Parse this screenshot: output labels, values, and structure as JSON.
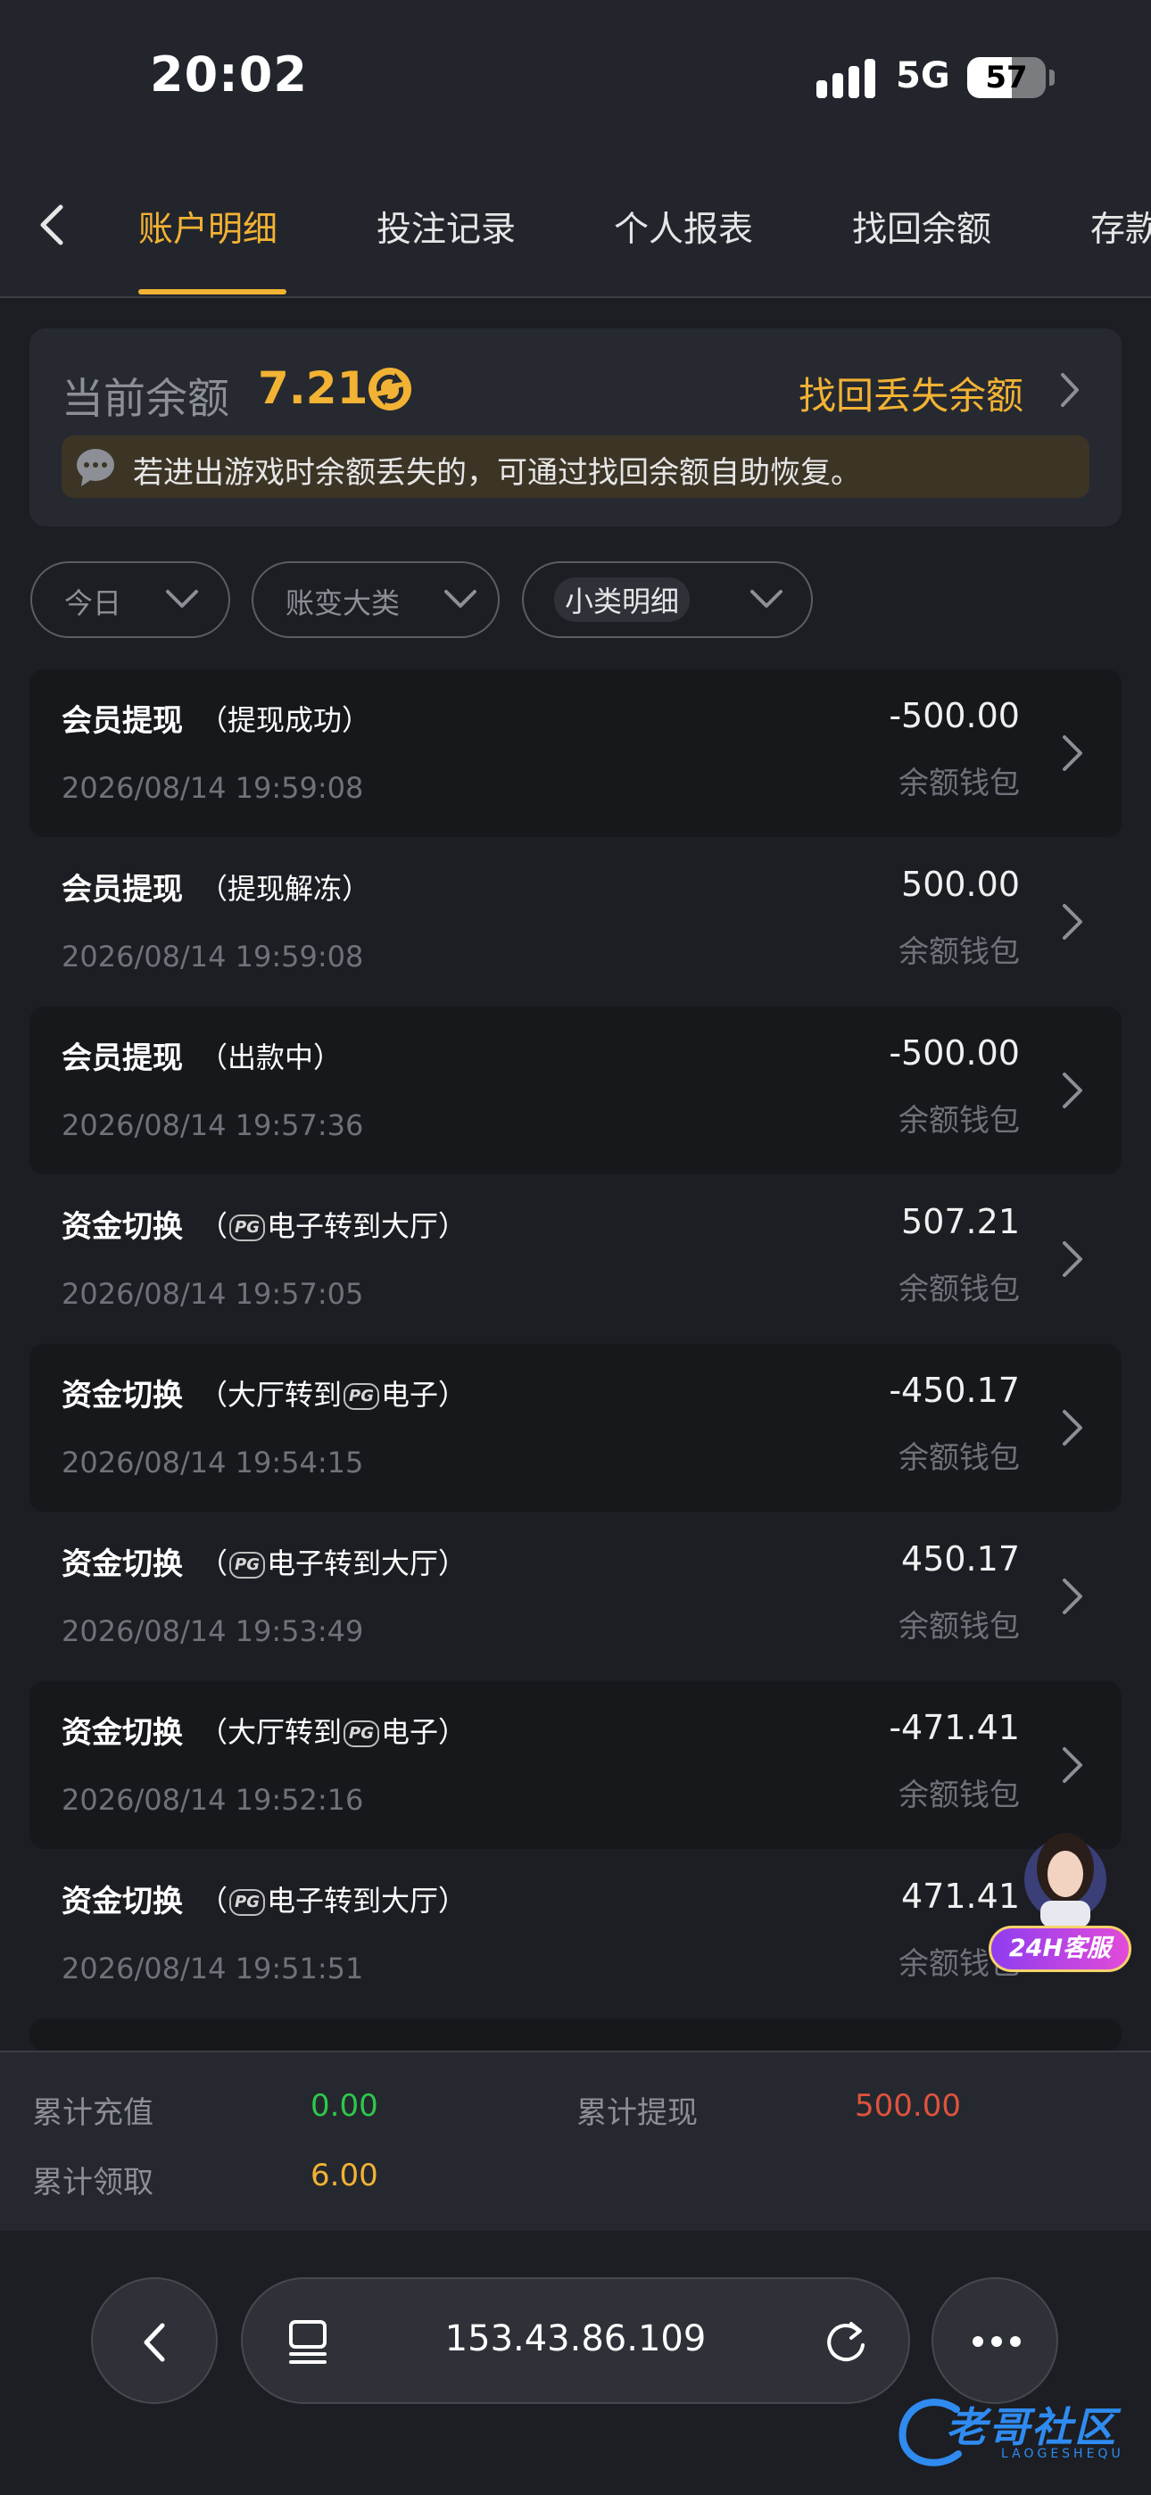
{
  "status_bar": {
    "time": "20:02",
    "network": "5G",
    "battery": "57",
    "battery_level": 0.57
  },
  "tabs": [
    {
      "label": "账户明细",
      "active": true
    },
    {
      "label": "投注记录",
      "active": false
    },
    {
      "label": "个人报表",
      "active": false
    },
    {
      "label": "找回余额",
      "active": false
    },
    {
      "label": "存款",
      "active": false
    }
  ],
  "balance": {
    "label": "当前余额",
    "value": "7.21",
    "recover_link": "找回丢失余额",
    "notice": "若进出游戏时余额丢失的，可通过找回余额自助恢复。"
  },
  "filters": [
    {
      "label": "今日",
      "active": false
    },
    {
      "label": "账变大类",
      "active": false
    },
    {
      "label": "小类明细",
      "active": true
    }
  ],
  "transactions": [
    {
      "type": "会员提现",
      "detail_prefix": "（提现成功）",
      "detail_suffix": "",
      "time": "2026/08/14 19:59:08",
      "amount": "-500.00",
      "wallet": "余额钱包"
    },
    {
      "type": "会员提现",
      "detail_prefix": "（提现解冻）",
      "detail_suffix": "",
      "time": "2026/08/14 19:59:08",
      "amount": "500.00",
      "wallet": "余额钱包"
    },
    {
      "type": "会员提现",
      "detail_prefix": "（出款中）",
      "detail_suffix": "",
      "time": "2026/08/14 19:57:36",
      "amount": "-500.00",
      "wallet": "余额钱包"
    },
    {
      "type": "资金切换",
      "detail_prefix": "（",
      "detail_suffix": "电子转到大厅）",
      "pg": "PG",
      "time": "2026/08/14 19:57:05",
      "amount": "507.21",
      "wallet": "余额钱包"
    },
    {
      "type": "资金切换",
      "detail_prefix": "（大厅转到",
      "detail_suffix": "电子）",
      "pg": "PG",
      "time": "2026/08/14 19:54:15",
      "amount": "-450.17",
      "wallet": "余额钱包"
    },
    {
      "type": "资金切换",
      "detail_prefix": "（",
      "detail_suffix": "电子转到大厅）",
      "pg": "PG",
      "time": "2026/08/14 19:53:49",
      "amount": "450.17",
      "wallet": "余额钱包"
    },
    {
      "type": "资金切换",
      "detail_prefix": "（大厅转到",
      "detail_suffix": "电子）",
      "pg": "PG",
      "time": "2026/08/14 19:52:16",
      "amount": "-471.41",
      "wallet": "余额钱包"
    },
    {
      "type": "资金切换",
      "detail_prefix": "（",
      "detail_suffix": "电子转到大厅）",
      "pg": "PG",
      "time": "2026/08/14 19:51:51",
      "amount": "471.41",
      "wallet": "余额钱包"
    }
  ],
  "support": {
    "label": "24H客服"
  },
  "summary": {
    "total_deposit_label": "累计充值",
    "total_deposit": "0.00",
    "total_withdraw_label": "累计提现",
    "total_withdraw": "500.00",
    "total_claim_label": "累计领取",
    "total_claim": "6.00"
  },
  "browser": {
    "url": "153.43.86.109"
  },
  "watermark": {
    "text": "老哥社区",
    "sub": "LAOGESHEQU"
  },
  "colors": {
    "accent": "#f2b233",
    "positive": "#2ec84a",
    "negative": "#e0533d",
    "background": "#1c1e23"
  }
}
